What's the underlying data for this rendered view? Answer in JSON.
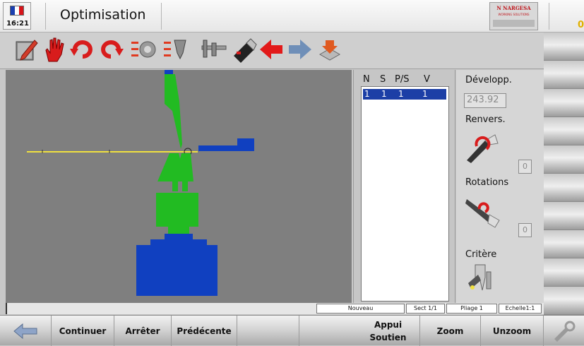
{
  "header": {
    "clock": "16:21",
    "title": "Optimisation",
    "logo": {
      "brand": "N NARGESA",
      "tagline": "WORKING SOLUTIONS"
    },
    "indicator": "0",
    "flag_colors": [
      "#1a3fb0",
      "#ffffff",
      "#d7141a"
    ]
  },
  "toolbar": {
    "icons": [
      "edit-icon",
      "hand-stop-icon",
      "rotate-ccw-icon",
      "rotate-cw-icon",
      "settings-list-icon",
      "tool-list-icon",
      "caliper-icon",
      "usb-icon",
      "arrow-left-icon",
      "arrow-right-icon",
      "download-icon"
    ]
  },
  "canvas": {
    "background": "#7f7f7f",
    "punch_color": "#22bb22",
    "die_color": "#1040c0",
    "line_color": "#f0e040"
  },
  "steps_table": {
    "columns": [
      "N",
      "S",
      "P/S",
      "V"
    ],
    "rows": [
      [
        "1",
        "1",
        "1",
        "1"
      ]
    ]
  },
  "properties": {
    "developpe_label": "Développ.",
    "developpe_value": "243.92",
    "renvers_label": "Renvers.",
    "renvers_value": "0",
    "rotations_label": "Rotations",
    "rotations_value": "0",
    "critere_label": "Critère"
  },
  "status": {
    "mode": "Nouveau",
    "section": "Sect 1/1",
    "bend": "Pliage 1",
    "scale": "Echelle1:1"
  },
  "bottom": {
    "back_icon": "arrow-back-icon",
    "continue": "Continuer",
    "stop": "Arrêter",
    "previous": "Prédécente",
    "support_line1": "Appui",
    "support_line2": "Soutien",
    "zoom": "Zoom",
    "unzoom": "Unzoom",
    "settings_icon": "tools-icon"
  }
}
